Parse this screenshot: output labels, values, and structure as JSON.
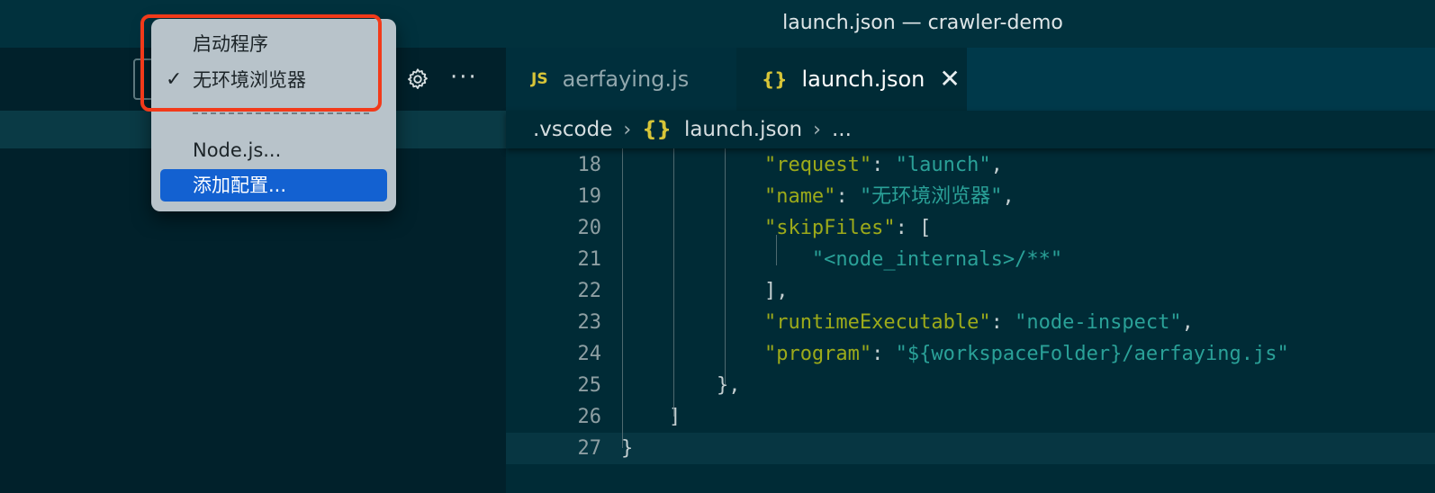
{
  "window": {
    "title": "launch.json — crawler-demo"
  },
  "sidebar": {
    "more_label": "···"
  },
  "menu": {
    "items": [
      {
        "label": "启动程序",
        "checked": false,
        "active": false
      },
      {
        "label": "无环境浏览器",
        "checked": true,
        "active": false
      },
      {
        "label": "Node.js...",
        "checked": false,
        "active": false
      },
      {
        "label": "添加配置...",
        "checked": false,
        "active": true
      }
    ],
    "check_mark": "✓"
  },
  "tabs": [
    {
      "icon": "JS",
      "label": "aerfaying.js",
      "active": false
    },
    {
      "icon": "{}",
      "label": "launch.json",
      "active": true,
      "close": "✕"
    }
  ],
  "breadcrumb": {
    "folder": ".vscode",
    "icon": "{}",
    "file": "launch.json",
    "tail": "...",
    "separator": "›"
  },
  "code": {
    "lines": [
      {
        "n": "18",
        "indent": "            ",
        "key": "\"request\"",
        "sep": ": ",
        "val": "\"launch\"",
        "end": ","
      },
      {
        "n": "19",
        "indent": "            ",
        "key": "\"name\"",
        "sep": ": ",
        "val": "\"无环境浏览器\"",
        "end": ","
      },
      {
        "n": "20",
        "indent": "            ",
        "key": "\"skipFiles\"",
        "sep": ": ",
        "val": "",
        "end": "["
      },
      {
        "n": "21",
        "indent": "                ",
        "key": "",
        "sep": "",
        "val": "\"<node_internals>/**\"",
        "end": ""
      },
      {
        "n": "22",
        "indent": "            ",
        "key": "",
        "sep": "",
        "val": "",
        "end": "],"
      },
      {
        "n": "23",
        "indent": "            ",
        "key": "\"runtimeExecutable\"",
        "sep": ": ",
        "val": "\"node-inspect\"",
        "end": ","
      },
      {
        "n": "24",
        "indent": "            ",
        "key": "\"program\"",
        "sep": ": ",
        "val": "\"${workspaceFolder}/aerfaying.js\"",
        "end": ""
      },
      {
        "n": "25",
        "indent": "        ",
        "key": "",
        "sep": "",
        "val": "",
        "end": "},"
      },
      {
        "n": "26",
        "indent": "    ",
        "key": "",
        "sep": "",
        "val": "",
        "end": "]"
      },
      {
        "n": "27",
        "indent": "",
        "key": "",
        "sep": "",
        "val": "",
        "end": "}"
      }
    ],
    "current_line": "27"
  },
  "colors": {
    "highlight": "#f23a1a",
    "menu_active": "#1361d1",
    "json_key": "#9caa1a",
    "json_string": "#2aa198"
  }
}
